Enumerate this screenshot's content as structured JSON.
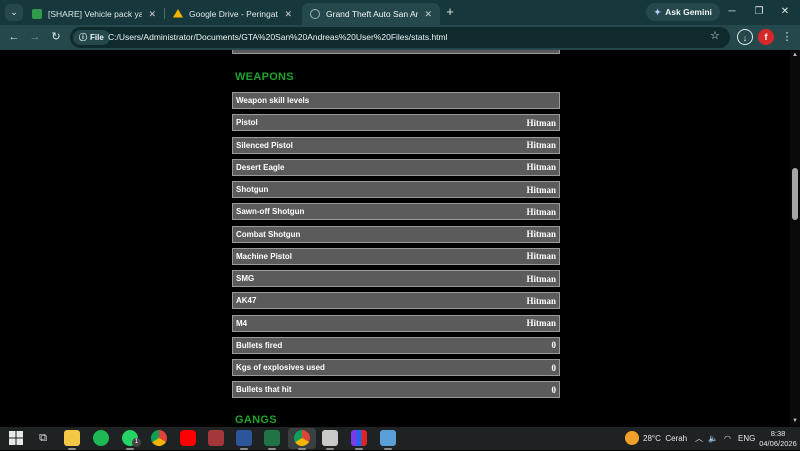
{
  "browser": {
    "tabs": [
      {
        "title": "[SHARE] Vehicle pack yang sep",
        "favicon_color": "#2e9b4a"
      },
      {
        "title": "Google Drive - Peringatan pem",
        "favicon_color": "#f4b400"
      },
      {
        "title": "Grand Theft Auto San Andreas",
        "favicon_color": "#9fb5b7"
      }
    ],
    "new_tab": "+",
    "ask_gemini": "Ask Gemini",
    "address_chip": "File",
    "url": "C:/Users/Administrator/Documents/GTA%20San%20Andreas%20User%20Files/stats.html"
  },
  "page": {
    "weapons_heading": "WEAPONS",
    "gangs_heading": "GANGS",
    "skill_header": "Weapon skill levels",
    "weapons": [
      {
        "label": "Pistol",
        "value": "Hitman"
      },
      {
        "label": "Silenced Pistol",
        "value": "Hitman"
      },
      {
        "label": "Desert Eagle",
        "value": "Hitman"
      },
      {
        "label": "Shotgun",
        "value": "Hitman"
      },
      {
        "label": "Sawn-off Shotgun",
        "value": "Hitman"
      },
      {
        "label": "Combat Shotgun",
        "value": "Hitman"
      },
      {
        "label": "Machine Pistol",
        "value": "Hitman"
      },
      {
        "label": "SMG",
        "value": "Hitman"
      },
      {
        "label": "AK47",
        "value": "Hitman"
      },
      {
        "label": "M4",
        "value": "Hitman"
      }
    ],
    "stats": [
      {
        "label": "Bullets fired",
        "value": "0"
      },
      {
        "label": "Kgs of explosives used",
        "value": "0"
      },
      {
        "label": "Bullets that hit",
        "value": "0"
      }
    ]
  },
  "taskbar": {
    "weather_temp": "28°C",
    "weather_text": "Cerah",
    "language": "ENG",
    "time": "8:38",
    "date": "04/06/2026",
    "whatsapp_badge": "1"
  },
  "colors": {
    "heading_green": "#1fa32a",
    "row_bg": "#5b5b5b",
    "chrome_dark": "#16373b",
    "chrome_toolbar": "#24484c"
  }
}
